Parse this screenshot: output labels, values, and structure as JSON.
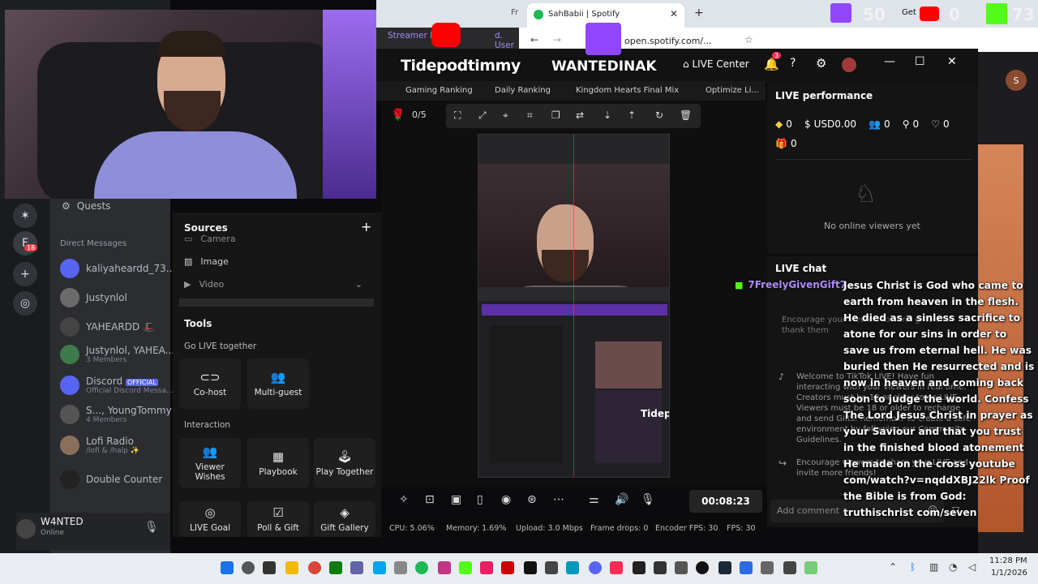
{
  "discord": {
    "quests_label": "Quests",
    "direct_messages_label": "Direct Messages",
    "server_badge": "18",
    "dms": [
      {
        "name": "kaliyaheardd_73...",
        "sub": ""
      },
      {
        "name": "Justynlol",
        "sub": ""
      },
      {
        "name": "YAHEARDD 🎩",
        "sub": ""
      },
      {
        "name": "Justynlol, YAHEA...",
        "sub": "3 Members"
      },
      {
        "name": "Discord",
        "badge": "OFFICIAL",
        "sub": "Official Discord Messa..."
      },
      {
        "name": "S..., YoungTommy",
        "sub": "4 Members"
      },
      {
        "name": "Lofi Radio",
        "sub": "/lofi & /halp ✨"
      },
      {
        "name": "Double Counter",
        "sub": ""
      }
    ],
    "user": {
      "name": "W4NTED",
      "status": "Online"
    }
  },
  "browser": {
    "tab_left_text": "Fr",
    "tab_active_title": "SahBabii | Spotify",
    "tab_right_text": "Get",
    "address": "open.spotify.com/...",
    "overlay_left": "Streamer M",
    "overlay_left2": "d. User",
    "overlay_numbers": "50",
    "overlay_num2": "0",
    "overlay_num3": "73"
  },
  "tiktok_studio": {
    "overlay_name_left": "Tidepodtimmy",
    "overlay_name_right": "WANTEDINAK",
    "live_center": "LIVE Center",
    "notif_count": "3",
    "bookmarks": [
      "Gaming Ranking",
      "Daily Ranking",
      "Kingdom Hearts Final Mix",
      "Optimize Li..."
    ],
    "scene_count": "0/5",
    "sources_title": "Sources",
    "sources": [
      "Camera",
      "Image",
      "Video"
    ],
    "tools_title": "Tools",
    "go_live_together": "Go LIVE together",
    "cohost": "Co-host",
    "multiguest": "Multi-guest",
    "interaction_title": "Interaction",
    "interaction_tools": [
      "Viewer Wishes",
      "Playbook",
      "Play Together"
    ],
    "more_tools": [
      "LIVE Goal",
      "Poll & Gift",
      "Gift Gallery"
    ],
    "timer": "00:08:23",
    "status": {
      "cpu": "CPU: 5.06%",
      "memory": "Memory: 1.69%",
      "upload": "Upload: 3.0 Mbps",
      "frame_drops": "Frame drops: 0",
      "encoder_fps": "Encoder FPS: 30",
      "fps": "FPS: 30"
    },
    "preview_overlay_name": "Tidep"
  },
  "live_panel": {
    "performance_title": "LIVE performance",
    "stats": {
      "coins": "0",
      "usd": "USD0.00",
      "viewers": "0",
      "followers": "0",
      "likes": "0",
      "gifts": "0"
    },
    "no_viewers": "No online viewers yet",
    "chat_title": "LIVE chat",
    "chat_user": "7FreelyGivenGift7",
    "chat_message": "Jesus Christ is God who came to earth from heaven in the flesh. He died as a sinless sacrifice to atone for our sins in order to save us from eternal hell. He was buried then He resurrected and is now in heaven and coming back soon to judge the world. Confess The Lord Jesus Christ in prayer as your Saviour and that you trust in the finished blood atonement He made on the cross youtube com/watch?v=nqddXBJ22lk Proof the Bible is from God: truthischrist com/seven",
    "encourage_text": "Encourage your viewers to send gifts and thank them",
    "welcome_text": "Welcome to TikTok LIVE! Have fun interacting with your viewers in real time. Creators must be 18 or older to go LIVE. Viewers must be 18 or older to recharge and send Gifts. Remember to create a safe environment by following our Community Guidelines.",
    "invite_text": "Encourage viewers to share your LIVE and invite more friends!",
    "comment_placeholder": "Add comment"
  },
  "taskbar": {
    "time": "11:28 PM",
    "date": "1/1/2026"
  }
}
